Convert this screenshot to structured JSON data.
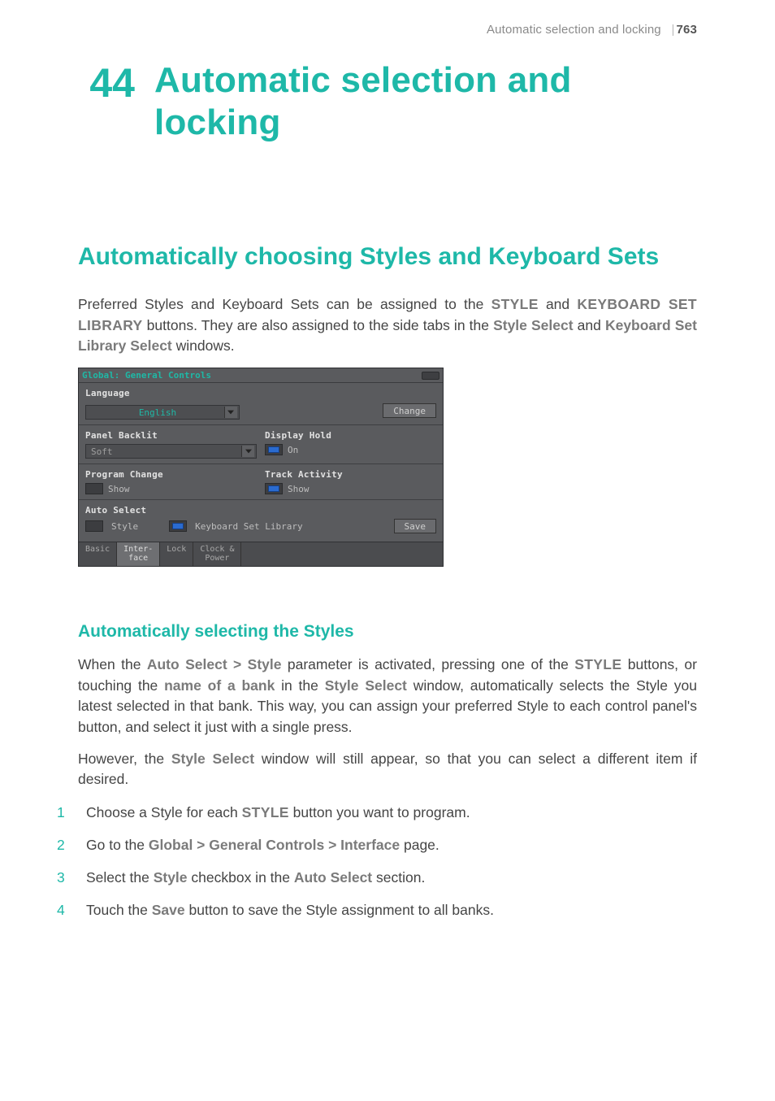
{
  "header": {
    "running_title": "Automatic selection and locking",
    "page_number": "763"
  },
  "chapter": {
    "number": "44",
    "title": "Automatic selection and locking"
  },
  "section_title": "Automatically choosing Styles and Keyboard Sets",
  "intro": {
    "t1": "Preferred Styles and Keyboard Sets can be assigned to the ",
    "c1": "STYLE",
    "t2": " and ",
    "c2": "KEYBOARD SET LIBRARY",
    "t3": " buttons. They are also assigned to the side tabs in the ",
    "s1": "Style Select",
    "t4": " and ",
    "s2": "Keyboard Set Library Select",
    "t5": " windows."
  },
  "panel": {
    "title": "Global: General Controls",
    "language_label": "Language",
    "language_value": "English",
    "change_btn": "Change",
    "backlit_label": "Panel Backlit",
    "backlit_value": "Soft",
    "display_hold_label": "Display Hold",
    "display_hold_value": "On",
    "program_change_label": "Program Change",
    "program_change_value": "Show",
    "track_activity_label": "Track Activity",
    "track_activity_value": "Show",
    "auto_select_label": "Auto Select",
    "auto_style": "Style",
    "auto_kbset": "Keyboard Set Library",
    "save_btn": "Save",
    "tabs": {
      "basic": "Basic",
      "interface1": "Inter-",
      "interface2": "face",
      "lock": "Lock",
      "clock1": "Clock &",
      "clock2": "Power"
    }
  },
  "subhead": "Automatically selecting the Styles",
  "para1": {
    "t1": "When the ",
    "s1": "Auto Select > Style",
    "t2": " parameter is activated, pressing one of the ",
    "c1": "STYLE",
    "t3": " buttons, or touching the ",
    "s2": "name of a bank",
    "t4": " in the ",
    "s3": "Style Select",
    "t5": " window, automatically selects the Style you latest selected in that bank. This way, you can assign your preferred Style to each control panel's button, and select it just with a single press."
  },
  "para2": {
    "t1": "However, the ",
    "s1": "Style Select",
    "t2": " window will still appear, so that you can select a different item if desired."
  },
  "steps": {
    "n1": "1",
    "n2": "2",
    "n3": "3",
    "n4": "4",
    "s1a": "Choose a Style for each ",
    "s1b": "STYLE",
    "s1c": " button you want to program.",
    "s2a": "Go to the ",
    "s2b": "Global > General Controls > Interface",
    "s2c": " page.",
    "s3a": "Select the ",
    "s3b": "Style",
    "s3c": " checkbox in the ",
    "s3d": "Auto Select",
    "s3e": " section.",
    "s4a": "Touch the ",
    "s4b": "Save",
    "s4c": " button to save the Style assignment to all banks."
  }
}
